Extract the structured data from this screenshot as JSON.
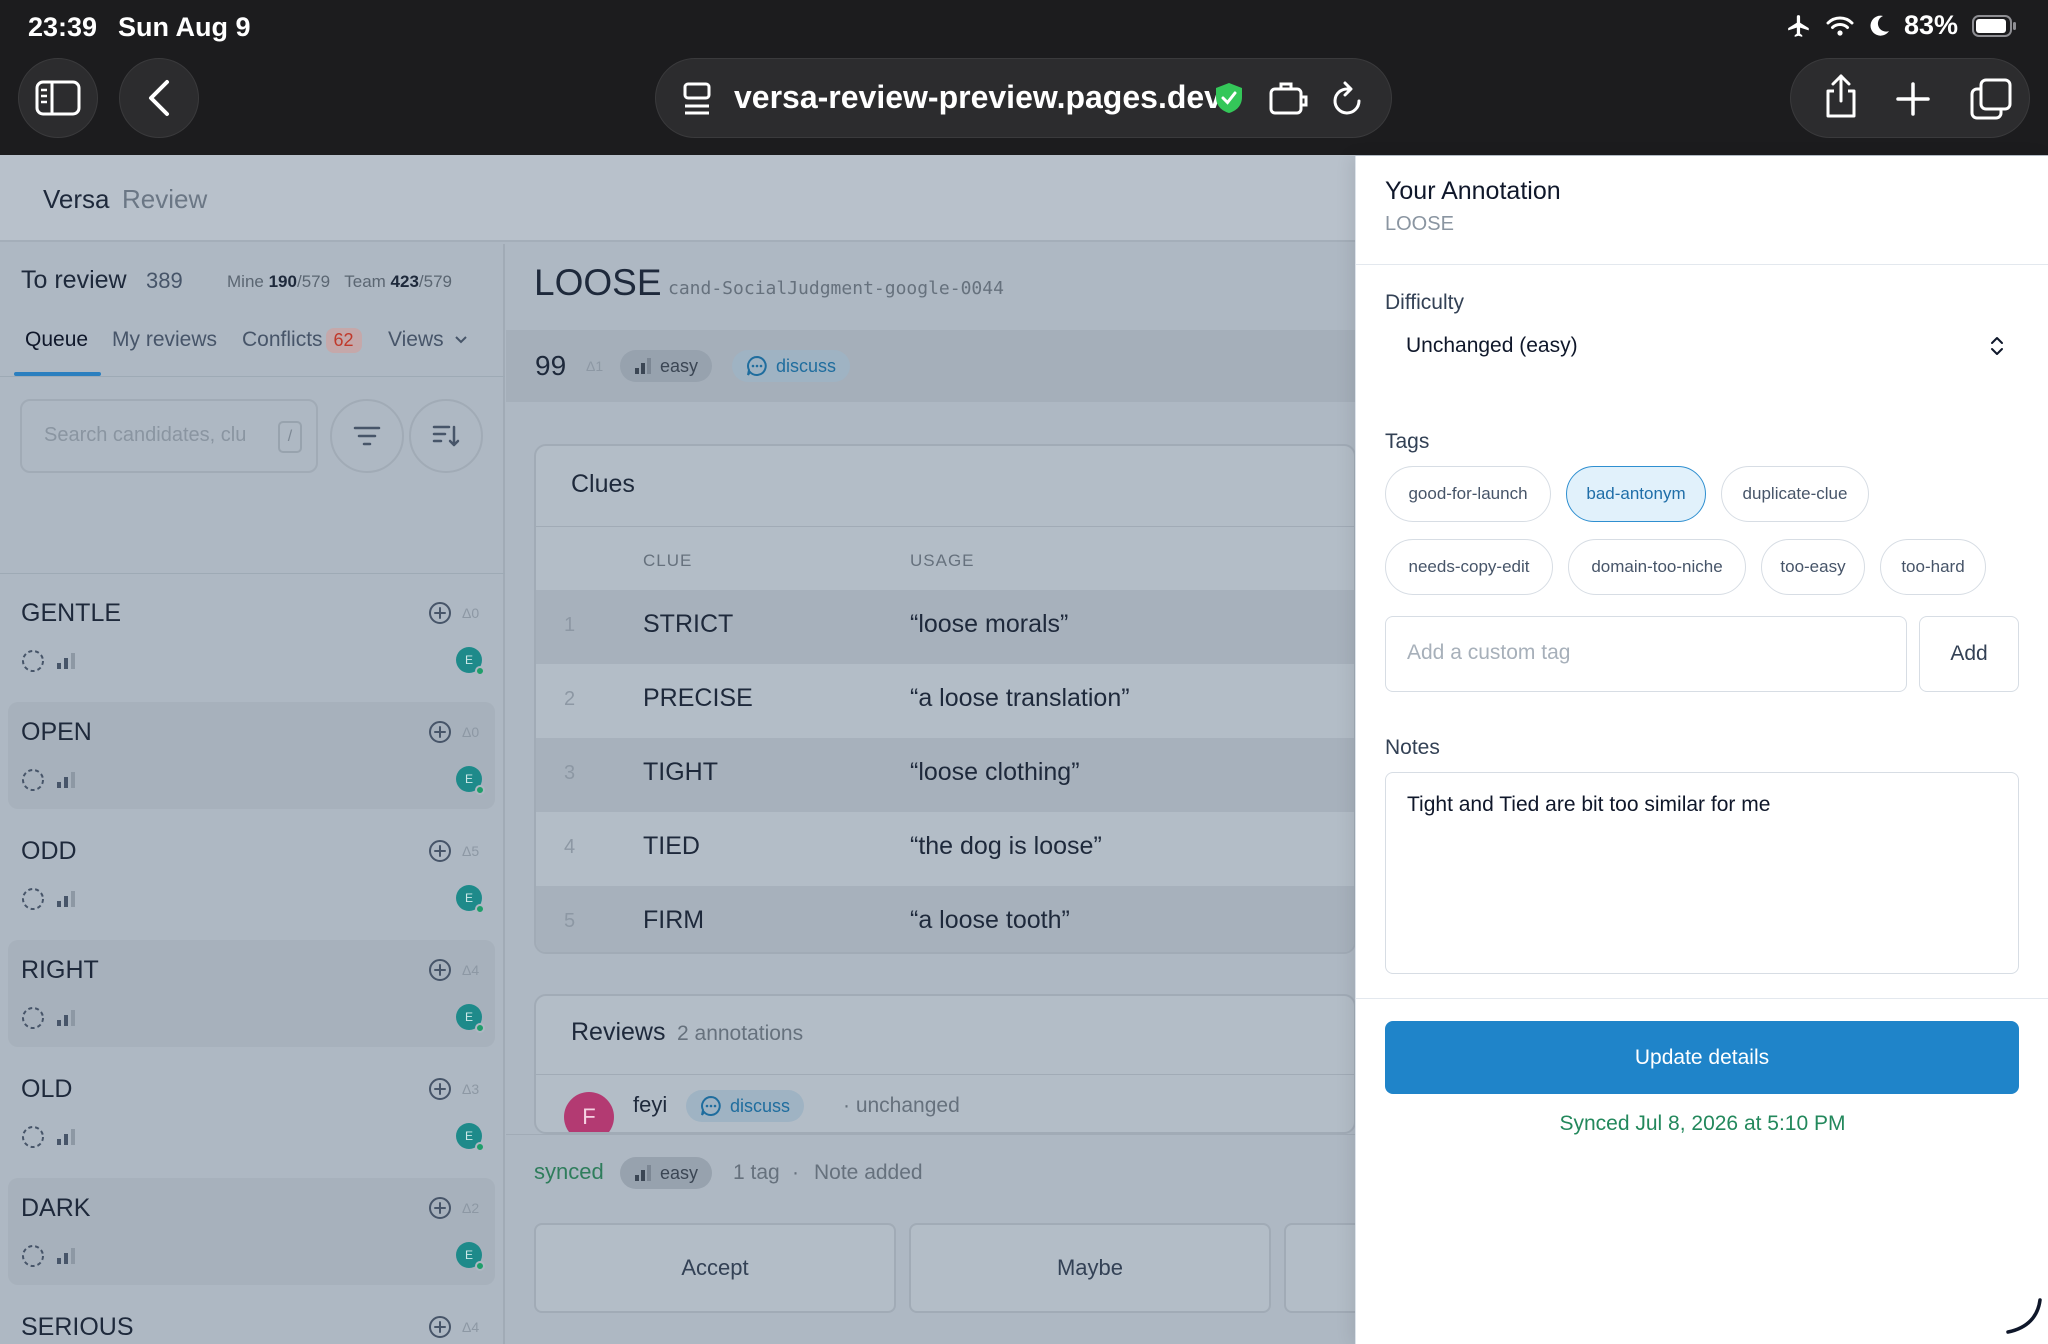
{
  "status": {
    "time": "23:39",
    "date": "Sun Aug 9",
    "battery": "83%"
  },
  "browser": {
    "url": "versa-review-preview.pages.dev"
  },
  "app": {
    "brand": "Versa",
    "section": "Review"
  },
  "queue_panel": {
    "title": "To review",
    "count": "389",
    "mine_label": "Mine",
    "mine_done": "190",
    "mine_total": "/579",
    "team_label": "Team",
    "team_done": "423",
    "team_total": "/579",
    "tabs": [
      "Queue",
      "My reviews",
      "Conflicts",
      "Views"
    ],
    "conflicts_count": "62",
    "search_placeholder": "Search candidates, clu",
    "search_shortcut": "/",
    "items": [
      {
        "word": "GENTLE",
        "delta": "Δ0",
        "avatar": "E"
      },
      {
        "word": "OPEN",
        "delta": "Δ0",
        "avatar": "E"
      },
      {
        "word": "ODD",
        "delta": "Δ5",
        "avatar": "E"
      },
      {
        "word": "RIGHT",
        "delta": "Δ4",
        "avatar": "E"
      },
      {
        "word": "OLD",
        "delta": "Δ3",
        "avatar": "E"
      },
      {
        "word": "DARK",
        "delta": "Δ2",
        "avatar": "E"
      },
      {
        "word": "SERIOUS",
        "delta": "Δ4",
        "avatar": "E"
      }
    ]
  },
  "candidate": {
    "word": "LOOSE",
    "id": "cand-SocialJudgment-google-0044",
    "score": "99",
    "score_delta": "Δ1",
    "difficulty_pill": "easy",
    "discuss_pill": "discuss"
  },
  "clues": {
    "title": "Clues",
    "col_clue": "CLUE",
    "col_usage": "USAGE",
    "rows": [
      {
        "n": "1",
        "clue": "STRICT",
        "usage": "“loose morals”"
      },
      {
        "n": "2",
        "clue": "PRECISE",
        "usage": "“a loose translation”"
      },
      {
        "n": "3",
        "clue": "TIGHT",
        "usage": "“loose clothing”"
      },
      {
        "n": "4",
        "clue": "TIED",
        "usage": "“the dog is loose”"
      },
      {
        "n": "5",
        "clue": "FIRM",
        "usage": "“a loose tooth”"
      }
    ]
  },
  "reviews": {
    "title": "Reviews",
    "count": "2 annotations",
    "entries": [
      {
        "avatar": "F",
        "name": "feyi",
        "tag": "discuss",
        "status": "· unchanged"
      }
    ]
  },
  "summary_bar": {
    "state": "synced",
    "difficulty": "easy",
    "tags": "1 tag",
    "sep": "·",
    "note": "Note added",
    "actions": [
      "Accept",
      "Maybe"
    ]
  },
  "annotation": {
    "title": "Your Annotation",
    "word": "LOOSE",
    "difficulty_label": "Difficulty",
    "difficulty_value": "Unchanged (easy)",
    "tags_label": "Tags",
    "tags": [
      {
        "label": "good-for-launch",
        "selected": false
      },
      {
        "label": "bad-antonym",
        "selected": true
      },
      {
        "label": "duplicate-clue",
        "selected": false
      },
      {
        "label": "needs-copy-edit",
        "selected": false
      },
      {
        "label": "domain-too-niche",
        "selected": false
      },
      {
        "label": "too-easy",
        "selected": false
      },
      {
        "label": "too-hard",
        "selected": false
      }
    ],
    "custom_tag_placeholder": "Add a custom tag",
    "add_label": "Add",
    "notes_label": "Notes",
    "notes_value": "Tight and Tied are bit too similar for me",
    "update_label": "Update details",
    "synced_msg": "Synced Jul 8, 2026 at 5:10 PM"
  },
  "colors": {
    "accent": "#1f84c9",
    "selected_chip_bg": "#e1f1fb",
    "synced_green": "#23885c",
    "conflict_red": "#c0392b"
  }
}
